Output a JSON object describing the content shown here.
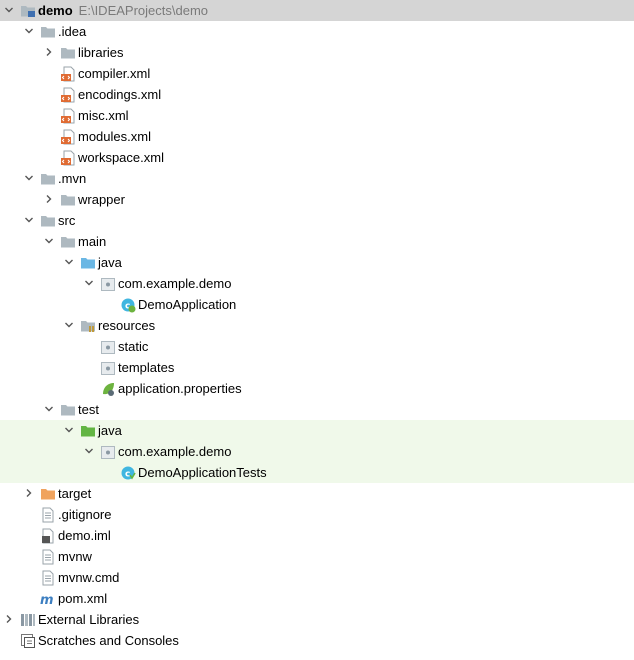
{
  "project": {
    "name": "demo",
    "path": "E:\\IDEAProjects\\demo"
  },
  "tree": [
    {
      "label": "demo",
      "path": "E:\\IDEAProjects\\demo",
      "depth": 0,
      "expand": "expanded",
      "icon": "module-folder-icon",
      "root": true
    },
    {
      "label": ".idea",
      "depth": 1,
      "expand": "expanded",
      "icon": "folder-icon"
    },
    {
      "label": "libraries",
      "depth": 2,
      "expand": "collapsed",
      "icon": "folder-icon"
    },
    {
      "label": "compiler.xml",
      "depth": 2,
      "expand": "none",
      "icon": "xml-file-icon"
    },
    {
      "label": "encodings.xml",
      "depth": 2,
      "expand": "none",
      "icon": "xml-file-icon"
    },
    {
      "label": "misc.xml",
      "depth": 2,
      "expand": "none",
      "icon": "xml-file-icon"
    },
    {
      "label": "modules.xml",
      "depth": 2,
      "expand": "none",
      "icon": "xml-file-icon"
    },
    {
      "label": "workspace.xml",
      "depth": 2,
      "expand": "none",
      "icon": "xml-file-icon"
    },
    {
      "label": ".mvn",
      "depth": 1,
      "expand": "expanded",
      "icon": "folder-icon"
    },
    {
      "label": "wrapper",
      "depth": 2,
      "expand": "collapsed",
      "icon": "folder-icon"
    },
    {
      "label": "src",
      "depth": 1,
      "expand": "expanded",
      "icon": "folder-icon"
    },
    {
      "label": "main",
      "depth": 2,
      "expand": "expanded",
      "icon": "folder-icon"
    },
    {
      "label": "java",
      "depth": 3,
      "expand": "expanded",
      "icon": "source-folder-icon"
    },
    {
      "label": "com.example.demo",
      "depth": 4,
      "expand": "expanded",
      "icon": "package-icon"
    },
    {
      "label": "DemoApplication",
      "depth": 5,
      "expand": "none",
      "icon": "spring-class-icon"
    },
    {
      "label": "resources",
      "depth": 3,
      "expand": "expanded",
      "icon": "resources-folder-icon"
    },
    {
      "label": "static",
      "depth": 4,
      "expand": "none",
      "icon": "package-icon"
    },
    {
      "label": "templates",
      "depth": 4,
      "expand": "none",
      "icon": "package-icon"
    },
    {
      "label": "application.properties",
      "depth": 4,
      "expand": "none",
      "icon": "spring-properties-icon"
    },
    {
      "label": "test",
      "depth": 2,
      "expand": "expanded",
      "icon": "folder-icon"
    },
    {
      "label": "java",
      "depth": 3,
      "expand": "expanded",
      "icon": "test-folder-icon",
      "test": true
    },
    {
      "label": "com.example.demo",
      "depth": 4,
      "expand": "expanded",
      "icon": "package-icon",
      "test": true
    },
    {
      "label": "DemoApplicationTests",
      "depth": 5,
      "expand": "none",
      "icon": "test-class-icon",
      "test": true
    },
    {
      "label": "target",
      "depth": 1,
      "expand": "collapsed",
      "icon": "excluded-folder-icon"
    },
    {
      "label": ".gitignore",
      "depth": 1,
      "expand": "none",
      "icon": "text-file-icon"
    },
    {
      "label": "demo.iml",
      "depth": 1,
      "expand": "none",
      "icon": "iml-file-icon"
    },
    {
      "label": "mvnw",
      "depth": 1,
      "expand": "none",
      "icon": "text-file-icon"
    },
    {
      "label": "mvnw.cmd",
      "depth": 1,
      "expand": "none",
      "icon": "text-file-icon"
    },
    {
      "label": "pom.xml",
      "depth": 1,
      "expand": "none",
      "icon": "maven-file-icon"
    },
    {
      "label": "External Libraries",
      "depth": 0,
      "expand": "collapsed",
      "icon": "libraries-icon"
    },
    {
      "label": "Scratches and Consoles",
      "depth": 0,
      "expand": "none",
      "icon": "scratches-icon"
    }
  ],
  "colors": {
    "root_row_bg": "#d5d5d5",
    "test_row_bg": "#f0f9ea",
    "folder": "#aeb9c0",
    "source_folder": "#6bb7e4",
    "test_folder": "#62b543",
    "excluded_folder": "#f0a35e",
    "xml_badge": "#e06b33",
    "spring": "#6db33f",
    "java_class": "#40b6e0"
  }
}
